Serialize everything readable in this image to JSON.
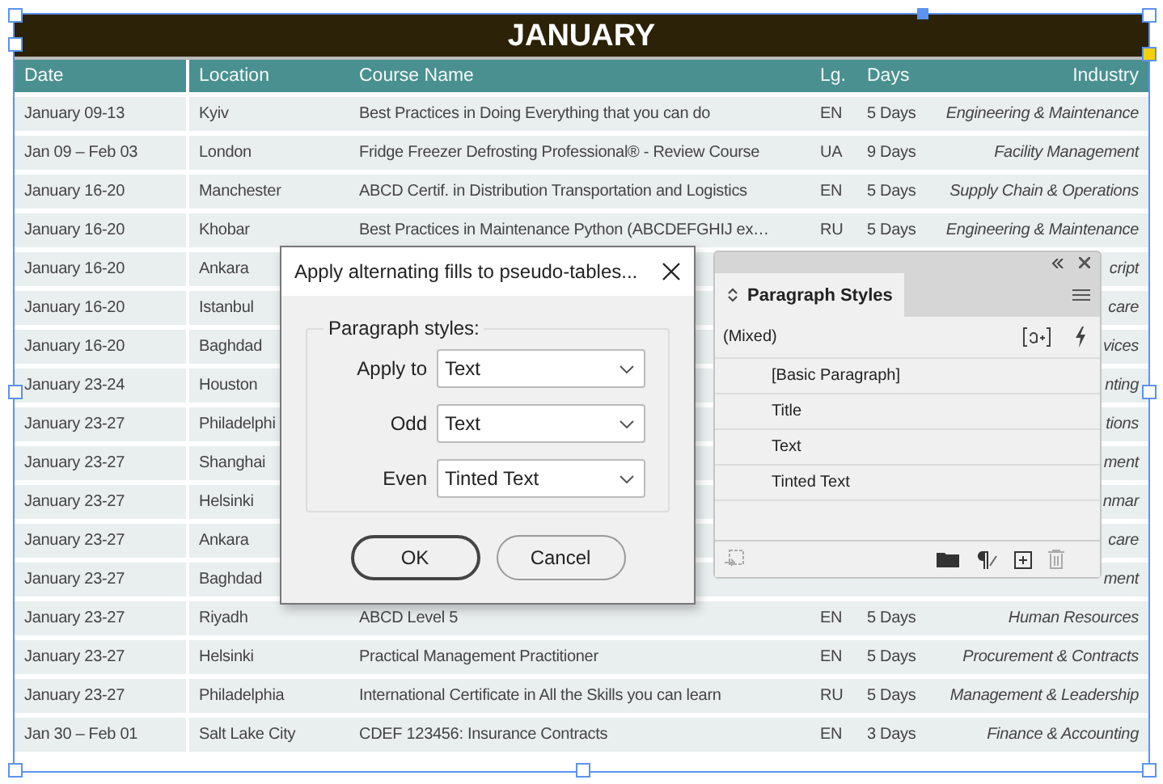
{
  "title": "JANUARY",
  "columns": [
    "Date",
    "Location",
    "Course Name",
    "Lg.",
    "Days",
    "Industry"
  ],
  "rows": [
    {
      "date": "January 09-13",
      "location": "Kyiv",
      "course": "Best Practices in Doing Everything that you can do",
      "lg": "EN",
      "days": "5 Days",
      "industry": "Engineering & Maintenance"
    },
    {
      "date": "Jan 09 – Feb 03",
      "location": "London",
      "course": "Fridge Freezer Defrosting Professional® - Review Course",
      "lg": "UA",
      "days": "9 Days",
      "industry": "Facility Management"
    },
    {
      "date": "January 16-20",
      "location": "Manchester",
      "course": "ABCD Certif. in Distribution Transportation and Logistics",
      "lg": "EN",
      "days": "5 Days",
      "industry": "Supply Chain & Operations"
    },
    {
      "date": "January 16-20",
      "location": "Khobar",
      "course": "Best Practices in Maintenance Python (ABCDEFGHIJ ex…",
      "lg": "RU",
      "days": "5 Days",
      "industry": "Engineering & Maintenance"
    },
    {
      "date": "January 16-20",
      "location": "Ankara",
      "industry": "cript"
    },
    {
      "date": "January 16-20",
      "location": "Istanbul",
      "industry": "care"
    },
    {
      "date": "January 16-20",
      "location": "Baghdad",
      "industry": "vices"
    },
    {
      "date": "January 23-24",
      "location": "Houston",
      "industry": "nting"
    },
    {
      "date": "January 23-27",
      "location": "Philadelphi",
      "industry": "tions"
    },
    {
      "date": "January 23-27",
      "location": "Shanghai",
      "industry": "ment"
    },
    {
      "date": "January 23-27",
      "location": "Helsinki",
      "industry": "nmar"
    },
    {
      "date": "January 23-27",
      "location": "Ankara",
      "industry": "care"
    },
    {
      "date": "January 23-27",
      "location": "Baghdad",
      "industry": "ment"
    },
    {
      "date": "January 23-27",
      "location": "Riyadh",
      "course": "ABCD Level 5",
      "lg": "EN",
      "days": "5 Days",
      "industry": "Human Resources"
    },
    {
      "date": "January 23-27",
      "location": "Helsinki",
      "course": "Practical Management Practitioner",
      "lg": "EN",
      "days": "5 Days",
      "industry": "Procurement & Contracts"
    },
    {
      "date": "January 23-27",
      "location": "Philadelphia",
      "course": "International Certificate in All the Skills you can learn",
      "lg": "RU",
      "days": "5 Days",
      "industry": "Management & Leadership"
    },
    {
      "date": "Jan 30 – Feb 01",
      "location": "Salt Lake City",
      "course": "CDEF 123456: Insurance Contracts",
      "lg": "EN",
      "days": "3 Days",
      "industry": "Finance & Accounting"
    }
  ],
  "dialog": {
    "title": "Apply alternating fills to pseudo-tables...",
    "group_label": "Paragraph styles:",
    "fields": [
      {
        "label": "Apply to",
        "value": "Text"
      },
      {
        "label": "Odd",
        "value": "Text"
      },
      {
        "label": "Even",
        "value": "Tinted Text"
      }
    ],
    "buttons": [
      {
        "label": "OK",
        "default": true
      },
      {
        "label": "Cancel",
        "default": false
      }
    ]
  },
  "panel": {
    "tab": "Paragraph Styles",
    "current": "(Mixed)",
    "styles": [
      "[Basic Paragraph]",
      "Title",
      "Text",
      "Tinted Text"
    ]
  }
}
